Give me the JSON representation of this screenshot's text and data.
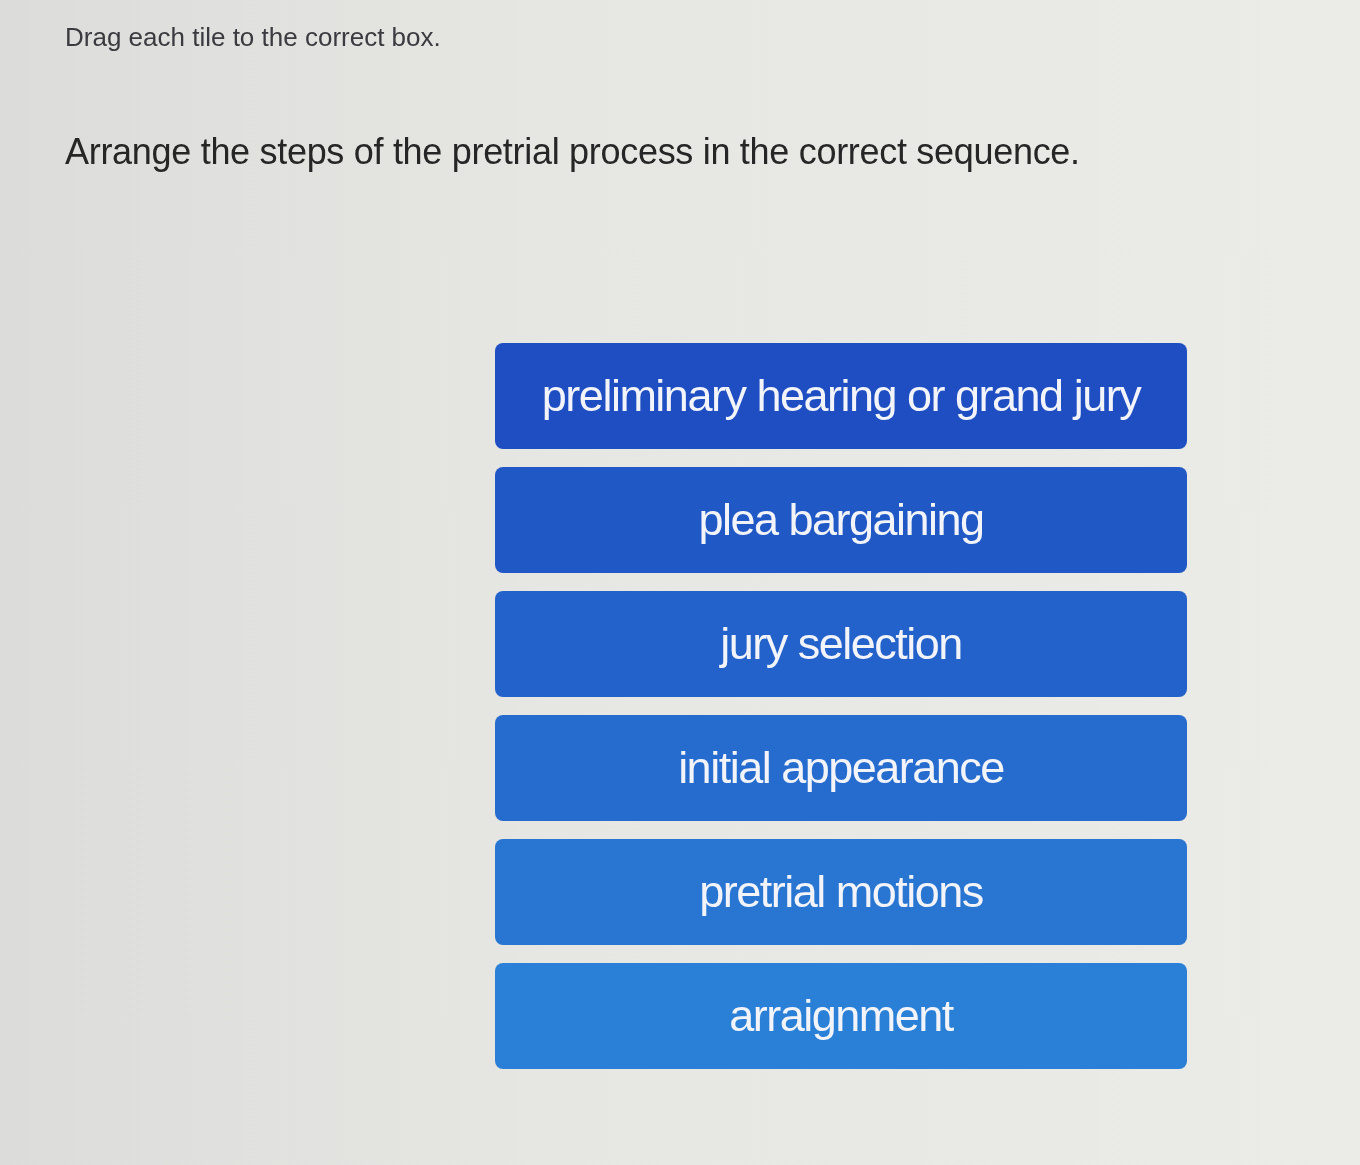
{
  "instruction": "Drag each tile to the correct box.",
  "question": "Arrange the steps of the pretrial process in the correct sequence.",
  "tiles": [
    {
      "label": "preliminary hearing or grand jury"
    },
    {
      "label": "plea bargaining"
    },
    {
      "label": "jury selection"
    },
    {
      "label": "initial appearance"
    },
    {
      "label": "pretrial motions"
    },
    {
      "label": "arraignment"
    }
  ]
}
